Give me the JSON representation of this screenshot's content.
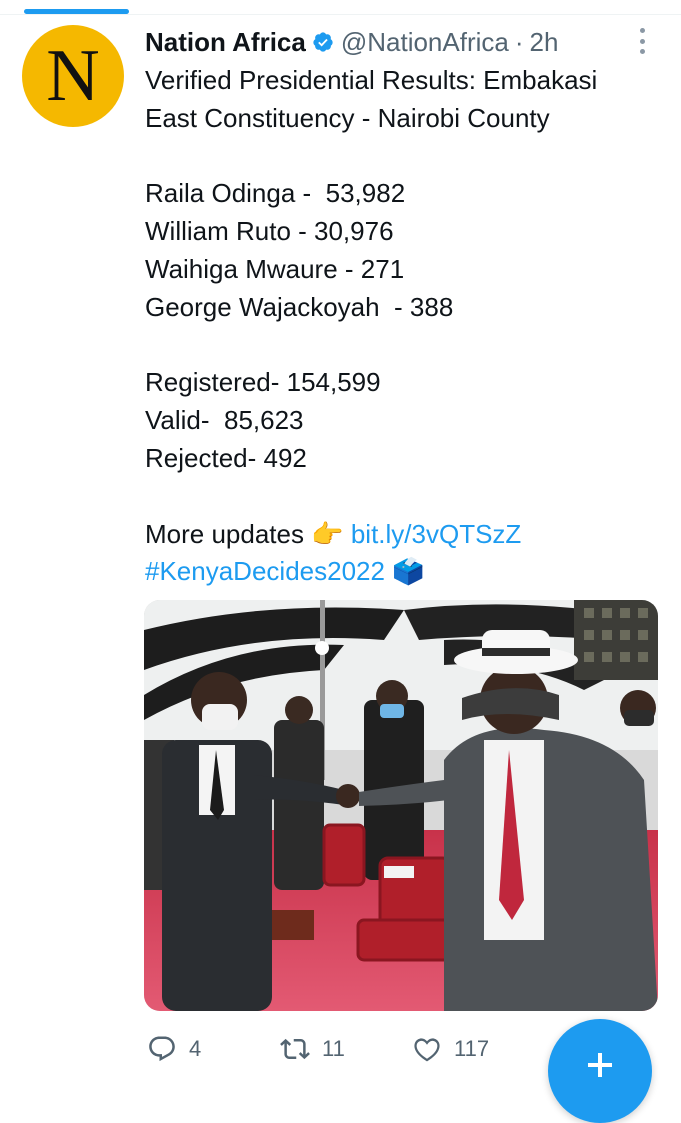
{
  "tweet": {
    "author_name": "Nation Africa",
    "handle": "@NationAfrica",
    "separator": "·",
    "time": "2h",
    "avatar_letter": "N",
    "lines": [
      "Verified Presidential Results: Embakasi",
      "East Constituency - Nairobi County",
      "",
      "Raila Odinga -  53,982",
      "William Ruto - 30,976",
      "Waihiga Mwaure - 271",
      "George Wajackoyah  - 388",
      "",
      "Registered- 154,599",
      "Valid-  85,623",
      "Rejected- 492",
      ""
    ],
    "more_updates_label": "More updates",
    "pointing_emoji": "👉",
    "link": "bit.ly/3vQTSzZ",
    "hashtag": "#KenyaDecides2022",
    "ballot_emoji": "🗳️"
  },
  "actions": {
    "reply_count": "4",
    "retweet_count": "11",
    "like_count": "117"
  },
  "colors": {
    "accent": "#1d9bf0",
    "avatar_bg": "#f5b800",
    "muted": "#536471"
  },
  "icons": [
    "verified-badge-icon",
    "more-icon",
    "reply-icon",
    "retweet-icon",
    "like-icon",
    "compose-plus-icon"
  ]
}
